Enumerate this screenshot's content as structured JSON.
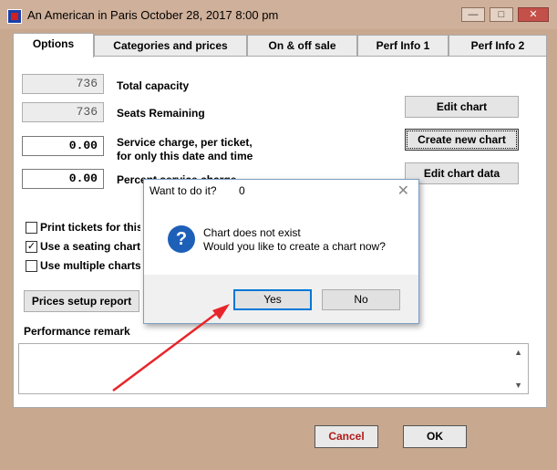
{
  "window": {
    "title": "An American in Paris October 28, 2017 8:00 pm",
    "controls": {
      "minimize": "—",
      "maximize": "□",
      "close": "✕"
    }
  },
  "tabs": [
    {
      "label": "Options",
      "active": true
    },
    {
      "label": "Categories and prices"
    },
    {
      "label": "On & off sale"
    },
    {
      "label": "Perf Info 1"
    },
    {
      "label": "Perf Info 2"
    }
  ],
  "options": {
    "total_capacity": {
      "value": "736",
      "label": "Total capacity"
    },
    "seats_remaining": {
      "value": "736",
      "label": "Seats Remaining"
    },
    "service_charge": {
      "value": "0.00",
      "label_line1": "Service charge, per ticket,",
      "label_line2": "for only this date and time"
    },
    "percent": {
      "value": "0.00",
      "label": "Percent service charge"
    },
    "checkboxes": [
      {
        "label": "Print tickets for this performance",
        "checked": false
      },
      {
        "label": "Use a seating chart",
        "checked": true
      },
      {
        "label": "Use multiple charts",
        "checked": false
      }
    ],
    "prices_setup_report": "Prices setup report",
    "edit_chart": "Edit chart",
    "create_new_chart": "Create new chart",
    "edit_chart_data": "Edit chart data",
    "performance_remark_label": "Performance remark",
    "scroll_up": "▲",
    "scroll_down": "▼"
  },
  "footer": {
    "cancel": "Cancel",
    "ok": "OK"
  },
  "dialog": {
    "title": "Want to do it?",
    "count": "0",
    "close": "✕",
    "icon": "?",
    "message_line1": "Chart does not exist",
    "message_line2": "Would you like to create a chart now?",
    "yes": "Yes",
    "no": "No"
  },
  "colors": {
    "accent_arrow": "#e8252b",
    "frame": "#c8a88e",
    "dialog_border": "#0078d7",
    "cancel_text": "#b01a1a"
  }
}
